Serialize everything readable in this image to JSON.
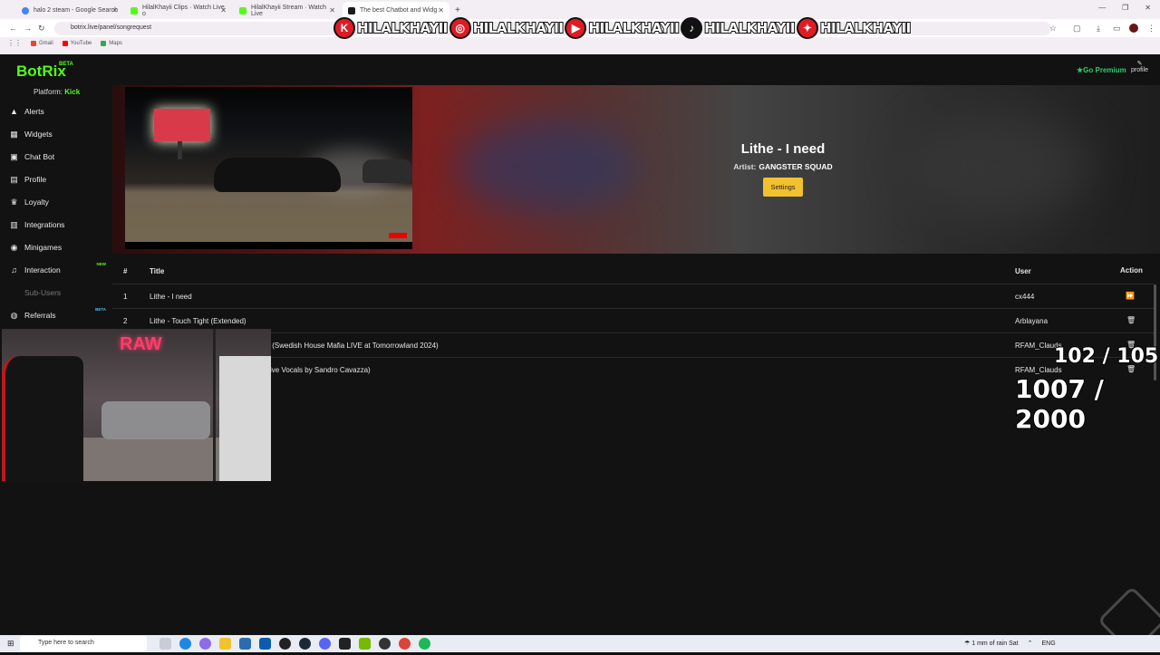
{
  "browser": {
    "tabs": [
      {
        "label": "halo 2 steam - Google Search",
        "color": "#4285f4"
      },
      {
        "label": "HilalKhayii Clips · Watch Live o",
        "color": "#53fc18"
      },
      {
        "label": "HilalKhayii Stream · Watch Live",
        "color": "#53fc18"
      },
      {
        "label": "The best Chatbot and Widg",
        "color": "#1b1b1b"
      }
    ],
    "url": "botrix.live/panel/songrequest",
    "bookmarks": [
      {
        "label": "Gmail",
        "color": "#ea4335"
      },
      {
        "label": "YouTube",
        "color": "#ff0000"
      },
      {
        "label": "Maps",
        "color": "#34a853"
      }
    ]
  },
  "overlay": {
    "socials": [
      {
        "icon": "kick-icon",
        "glyph": "K",
        "name": "HILALKHAYII"
      },
      {
        "icon": "instagram-icon",
        "glyph": "◎",
        "name": "HILALKHAYII"
      },
      {
        "icon": "youtube-icon",
        "glyph": "▶",
        "name": "HILALKHAYII"
      },
      {
        "icon": "tiktok-icon",
        "glyph": "♪",
        "name": "HILALKHAYII"
      },
      {
        "icon": "twitter-icon",
        "glyph": "✦",
        "name": "HILALKHAYII"
      }
    ],
    "webcam_sign": "RAW",
    "counter_top": "102 / 105",
    "counter_bottom": "1007 / 2000"
  },
  "app": {
    "logo": "BotRix",
    "logo_badge": "BETA",
    "premium": "Go Premium",
    "profile": "profile",
    "platform_label": "Platform:",
    "platform_value": "Kick",
    "sidebar": [
      {
        "label": "Alerts",
        "icon": "warning-icon",
        "glyph": "▲",
        "badge": ""
      },
      {
        "label": "Widgets",
        "icon": "grid-icon",
        "glyph": "▦",
        "badge": ""
      },
      {
        "label": "Chat Bot",
        "icon": "robot-icon",
        "glyph": "▣",
        "badge": ""
      },
      {
        "label": "Profile",
        "icon": "id-card-icon",
        "glyph": "▤",
        "badge": ""
      },
      {
        "label": "Loyalty",
        "icon": "trophy-icon",
        "glyph": "♛",
        "badge": ""
      },
      {
        "label": "Integrations",
        "icon": "puzzle-icon",
        "glyph": "▥",
        "badge": ""
      },
      {
        "label": "Minigames",
        "icon": "gamepad-icon",
        "glyph": "◉",
        "badge": ""
      },
      {
        "label": "Interaction",
        "icon": "music-icon",
        "glyph": "♫",
        "badge": "NEW"
      },
      {
        "label": "Sub-Users",
        "icon": "",
        "glyph": "",
        "badge": ""
      },
      {
        "label": "Referrals",
        "icon": "users-icon",
        "glyph": "◍",
        "badge": "BETA"
      }
    ],
    "now_playing": {
      "title": "Lithe - I need",
      "artist_label": "Artist:",
      "artist": "GANGSTER SQUAD",
      "settings": "Settings"
    },
    "queue": {
      "headers": {
        "num": "#",
        "title": "Title",
        "user": "User",
        "action": "Action"
      },
      "rows": [
        {
          "num": "1",
          "title": "Lithe - I need",
          "user": "cx444",
          "action": "skip-icon",
          "glyph": "⏩"
        },
        {
          "num": "2",
          "title": "Lithe - Touch Tight (Extended)",
          "user": "Arblayana",
          "action": "trash-icon",
          "glyph": "🗑"
        },
        {
          "num": "",
          "title": "y (Swedish House Mafia LIVE at Tomorrowland 2024)",
          "user": "RFAM_Clauds",
          "action": "trash-icon",
          "glyph": "🗑"
        },
        {
          "num": "",
          "title": "ive Vocals by Sandro Cavazza)",
          "user": "RFAM_Clauds",
          "action": "trash-icon",
          "glyph": "🗑"
        }
      ]
    }
  },
  "taskbar": {
    "search_placeholder": "Type here to search",
    "weather": "1 mm of rain Sat",
    "lang": "ENG"
  }
}
